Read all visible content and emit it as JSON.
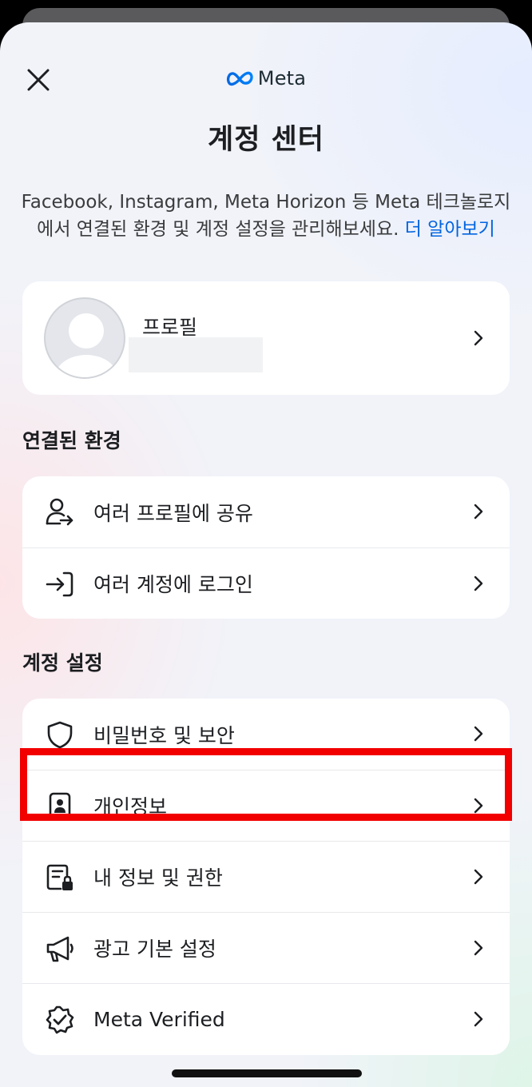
{
  "header": {
    "brand": "Meta",
    "title": "계정 센터",
    "subtitle": "Facebook, Instagram, Meta Horizon 등 Meta 테크놀로지에서 연결된 환경 및 계정 설정을 관리해보세요.",
    "learn_more": "더 알아보기"
  },
  "profile": {
    "label": "프로필"
  },
  "connected": {
    "section_title": "연결된 환경",
    "items": [
      {
        "label": "여러 프로필에 공유",
        "icon": "share-profiles-icon"
      },
      {
        "label": "여러 계정에 로그인",
        "icon": "login-icon"
      }
    ]
  },
  "settings": {
    "section_title": "계정 설정",
    "items": [
      {
        "label": "비밀번호 및 보안",
        "icon": "shield-icon"
      },
      {
        "label": "개인정보",
        "icon": "id-card-icon",
        "highlighted": true
      },
      {
        "label": "내 정보 및 권한",
        "icon": "document-lock-icon"
      },
      {
        "label": "광고 기본 설정",
        "icon": "megaphone-icon"
      },
      {
        "label": "Meta Verified",
        "icon": "verified-badge-icon"
      }
    ]
  },
  "colors": {
    "link": "#0064e0",
    "highlight": "#f20000"
  }
}
